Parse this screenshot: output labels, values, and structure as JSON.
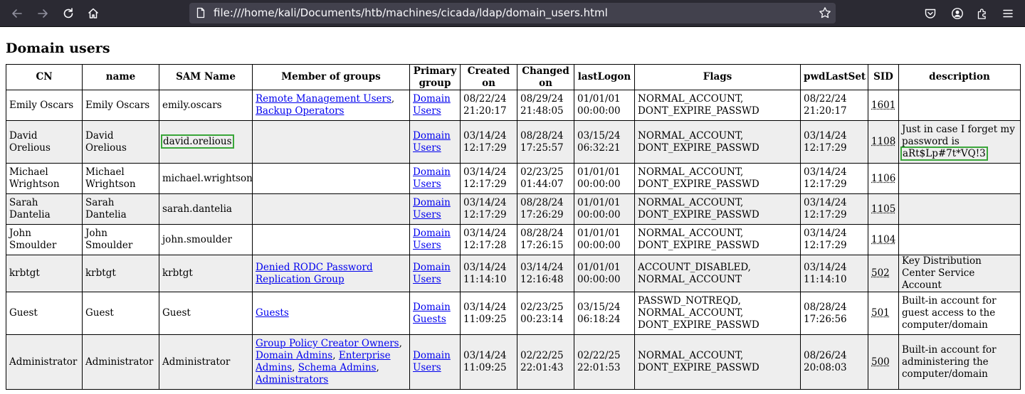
{
  "browser": {
    "url": "file:///home/kali/Documents/htb/machines/cicada/ldap/domain_users.html"
  },
  "page": {
    "title": "Domain users",
    "columns": [
      "CN",
      "name",
      "SAM Name",
      "Member of groups",
      "Primary group",
      "Created on",
      "Changed on",
      "lastLogon",
      "Flags",
      "pwdLastSet",
      "SID",
      "description"
    ],
    "rows": [
      {
        "cn": "Emily Oscars",
        "name": "Emily Oscars",
        "sam": "emily.oscars",
        "groups": [
          "Remote Management Users",
          "Backup Operators"
        ],
        "primary": "Domain Users",
        "created": "08/22/24 21:20:17",
        "changed": "08/29/24 21:48:05",
        "lastlogon": "01/01/01 00:00:00",
        "flags": "NORMAL_ACCOUNT, DONT_EXPIRE_PASSWD",
        "pwdlastset": "08/22/24 21:20:17",
        "sid": "1601",
        "description": ""
      },
      {
        "cn": "David Orelious",
        "name": "David Orelious",
        "sam": "david.orelious",
        "groups": [],
        "primary": "Domain Users",
        "created": "03/14/24 12:17:29",
        "changed": "08/28/24 17:25:57",
        "lastlogon": "03/15/24 06:32:21",
        "flags": "NORMAL_ACCOUNT, DONT_EXPIRE_PASSWD",
        "pwdlastset": "03/14/24 12:17:29",
        "sid": "1108",
        "description": "Just in case I forget my password is",
        "description_secret": "aRt$Lp#7t*VQ!3"
      },
      {
        "cn": "Michael Wrightson",
        "name": "Michael Wrightson",
        "sam": "michael.wrightson",
        "groups": [],
        "primary": "Domain Users",
        "created": "03/14/24 12:17:29",
        "changed": "02/23/25 01:44:07",
        "lastlogon": "01/01/01 00:00:00",
        "flags": "NORMAL_ACCOUNT, DONT_EXPIRE_PASSWD",
        "pwdlastset": "03/14/24 12:17:29",
        "sid": "1106",
        "description": ""
      },
      {
        "cn": "Sarah Dantelia",
        "name": "Sarah Dantelia",
        "sam": "sarah.dantelia",
        "groups": [],
        "primary": "Domain Users",
        "created": "03/14/24 12:17:29",
        "changed": "08/28/24 17:26:29",
        "lastlogon": "01/01/01 00:00:00",
        "flags": "NORMAL_ACCOUNT, DONT_EXPIRE_PASSWD",
        "pwdlastset": "03/14/24 12:17:29",
        "sid": "1105",
        "description": ""
      },
      {
        "cn": "John Smoulder",
        "name": "John Smoulder",
        "sam": "john.smoulder",
        "groups": [],
        "primary": "Domain Users",
        "created": "03/14/24 12:17:28",
        "changed": "08/28/24 17:26:15",
        "lastlogon": "01/01/01 00:00:00",
        "flags": "NORMAL_ACCOUNT, DONT_EXPIRE_PASSWD",
        "pwdlastset": "03/14/24 12:17:29",
        "sid": "1104",
        "description": ""
      },
      {
        "cn": "krbtgt",
        "name": "krbtgt",
        "sam": "krbtgt",
        "groups": [
          "Denied RODC Password Replication Group"
        ],
        "primary": "Domain Users",
        "created": "03/14/24 11:14:10",
        "changed": "03/14/24 12:16:48",
        "lastlogon": "01/01/01 00:00:00",
        "flags": "ACCOUNT_DISABLED, NORMAL_ACCOUNT",
        "pwdlastset": "03/14/24 11:14:10",
        "sid": "502",
        "description": "Key Distribution Center Service Account"
      },
      {
        "cn": "Guest",
        "name": "Guest",
        "sam": "Guest",
        "groups": [
          "Guests"
        ],
        "primary": "Domain Guests",
        "created": "03/14/24 11:09:25",
        "changed": "02/23/25 00:23:14",
        "lastlogon": "03/15/24 06:18:24",
        "flags": "PASSWD_NOTREQD, NORMAL_ACCOUNT, DONT_EXPIRE_PASSWD",
        "pwdlastset": "08/28/24 17:26:56",
        "sid": "501",
        "description": "Built-in account for guest access to the computer/domain"
      },
      {
        "cn": "Administrator",
        "name": "Administrator",
        "sam": "Administrator",
        "groups": [
          "Group Policy Creator Owners",
          "Domain Admins",
          "Enterprise Admins",
          "Schema Admins",
          "Administrators"
        ],
        "primary": "Domain Users",
        "created": "03/14/24 11:09:25",
        "changed": "02/22/25 22:01:43",
        "lastlogon": "02/22/25 22:01:53",
        "flags": "NORMAL_ACCOUNT, DONT_EXPIRE_PASSWD",
        "pwdlastset": "08/26/24 20:08:03",
        "sid": "500",
        "description": "Built-in account for administering the computer/domain"
      }
    ]
  }
}
